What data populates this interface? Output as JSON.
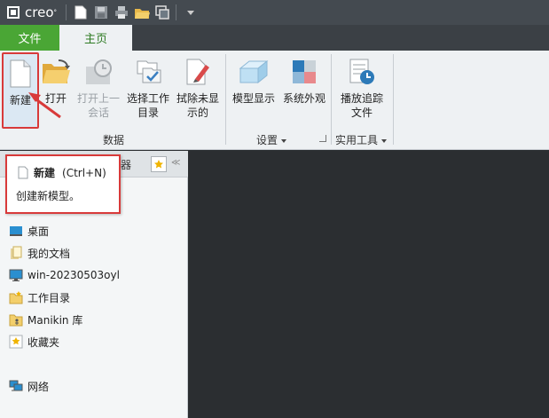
{
  "app": {
    "logo_text": "creo"
  },
  "qat": {
    "icons": [
      "new-icon",
      "save-icon",
      "print-icon",
      "open-icon",
      "window-icon",
      "dropdown-icon"
    ]
  },
  "tabs": {
    "file": "文件",
    "home": "主页"
  },
  "ribbon": {
    "buttons": {
      "new": "新建",
      "open": "打开",
      "open_last_1": "打开上一",
      "open_last_2": "会话",
      "select_wd_1": "选择工作",
      "select_wd_2": "目录",
      "erase_1": "拭除未显",
      "erase_2": "示的",
      "model_display": "模型显示",
      "system_appearance": "系统外观",
      "playback_1": "播放追踪",
      "playback_2": "文件"
    },
    "groups": {
      "data": "数据",
      "settings": "设置",
      "utilities": "实用工具"
    }
  },
  "panel": {
    "tab_partial": "器",
    "nav": {
      "desktop": "桌面",
      "my_docs": "我的文档",
      "computer": "win-20230503oyl",
      "working_dir": "工作目录",
      "manikin": "Manikin 库",
      "favorites": "收藏夹",
      "network": "网络"
    }
  },
  "tooltip": {
    "title": "新建",
    "shortcut": "(Ctrl+N)",
    "description": "创建新模型。"
  },
  "colors": {
    "accent_red": "#d83a3a",
    "file_tab_green": "#4aa635",
    "workspace": "#2b2e31"
  }
}
